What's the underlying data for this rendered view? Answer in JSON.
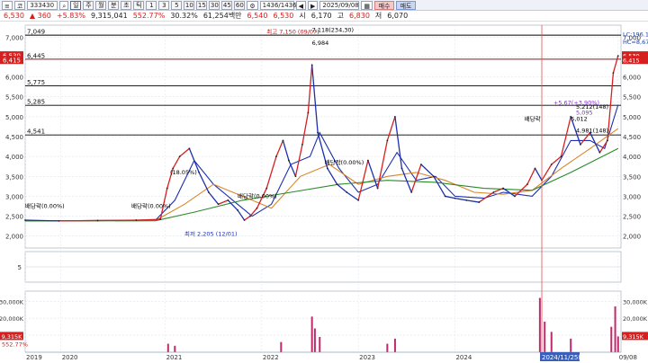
{
  "toolbar": {
    "menu_label": "≡",
    "market_label": "코",
    "code": "333430",
    "period_buttons": [
      "일",
      "주",
      "월",
      "분",
      "초",
      "틱"
    ],
    "minute_buttons": [
      "1",
      "3",
      "5",
      "10",
      "15",
      "30",
      "45",
      "60"
    ],
    "active_period": "일",
    "count": "1436/1436",
    "date": "2025/09/08",
    "buy_label": "매수",
    "sell_label": "매도"
  },
  "quote": {
    "price": "6,530",
    "change": "▲ 360",
    "change_rate": "+5.83%",
    "volume": "9,315,041",
    "volume_ratio": "552.77%",
    "turnover": "30.32%",
    "amount": "61,254백만",
    "open_label": "시",
    "open": "6,170",
    "high_label": "고",
    "high": "6,830",
    "low_label": "저",
    "low": "6,070",
    "close": "6,540",
    "prev": "6,530"
  },
  "chart_data": {
    "type": "line",
    "ylim": [
      1700,
      7300
    ],
    "y_ticks": [
      2000,
      2500,
      3000,
      3500,
      4000,
      4500,
      5000,
      5500,
      6000,
      6500,
      7000
    ],
    "y_tick_labels": [
      "2,000",
      "2,500",
      "3,000",
      "3,500",
      "4,000",
      "4,500",
      "5,000",
      "5,500",
      "6,000",
      "6,500",
      "7,000"
    ],
    "x_labels": [
      "2019",
      "2020",
      "2021",
      "2022",
      "2023",
      "2024",
      "09/08"
    ],
    "x_label_dates": [
      2019.55,
      2019.92,
      2021.0,
      2022.0,
      2023.0,
      2024.0,
      2025.69
    ],
    "x_range": [
      2019.55,
      2025.72
    ],
    "h_lines": [
      {
        "label": "7,049",
        "value": 7049,
        "color": "#000000"
      },
      {
        "label": "6,445",
        "value": 6445,
        "color": "#8a1a1a"
      },
      {
        "label": "5,775",
        "value": 5775,
        "color": "#000000"
      },
      {
        "label": "5,285",
        "value": 5285,
        "color": "#000000"
      },
      {
        "label": "4,541",
        "value": 4541,
        "color": "#000000"
      }
    ],
    "right_tags": [
      {
        "text": "LC:196.1",
        "value": 7070,
        "color": "#1a3fa8"
      },
      {
        "text": "HC=8,67",
        "value": 6880,
        "color": "#1a3fa8"
      },
      {
        "text": "6,530",
        "value": 6530,
        "color": "#ffffff",
        "bg": "#d62020"
      },
      {
        "text": "6,415",
        "value": 6415,
        "color": "#ffffff",
        "bg": "#d62020"
      }
    ],
    "left_price_tags": [
      {
        "text": "6,530",
        "value": 6530
      },
      {
        "text": "6,415",
        "value": 6415
      }
    ],
    "price_series": {
      "name": "close",
      "x": [
        2019.55,
        2019.9,
        2020.3,
        2020.7,
        2020.95,
        2021.02,
        2021.08,
        2021.15,
        2021.25,
        2021.35,
        2021.45,
        2021.55,
        2021.65,
        2021.75,
        2021.82,
        2021.88,
        2021.95,
        2022.05,
        2022.15,
        2022.22,
        2022.28,
        2022.35,
        2022.42,
        2022.48,
        2022.52,
        2022.58,
        2022.68,
        2022.78,
        2022.88,
        2023.0,
        2023.1,
        2023.2,
        2023.3,
        2023.38,
        2023.45,
        2023.55,
        2023.65,
        2023.78,
        2023.9,
        2024.0,
        2024.12,
        2024.25,
        2024.4,
        2024.5,
        2024.62,
        2024.75,
        2024.83,
        2024.9,
        2025.0,
        2025.1,
        2025.2,
        2025.3,
        2025.4,
        2025.5,
        2025.58,
        2025.64,
        2025.69
      ],
      "values": [
        2400,
        2380,
        2390,
        2400,
        2420,
        3200,
        3700,
        4000,
        4200,
        3600,
        3100,
        2800,
        2900,
        2650,
        2400,
        2500,
        2700,
        3200,
        4000,
        4400,
        3900,
        3500,
        4300,
        5100,
        6300,
        4600,
        3700,
        3300,
        3100,
        2900,
        3900,
        3200,
        4400,
        5000,
        3700,
        3100,
        3800,
        3500,
        3000,
        2950,
        2900,
        2850,
        3100,
        3200,
        3000,
        3300,
        3700,
        3400,
        3800,
        4000,
        5000,
        4300,
        4600,
        4100,
        4400,
        6100,
        6530
      ]
    },
    "ma_series": [
      {
        "name": "ma-short",
        "color": "#1c2fb0",
        "x": [
          2019.55,
          2020.9,
          2021.1,
          2021.3,
          2021.5,
          2021.7,
          2021.9,
          2022.1,
          2022.3,
          2022.5,
          2022.6,
          2022.8,
          2023.0,
          2023.2,
          2023.4,
          2023.6,
          2023.8,
          2024.0,
          2024.3,
          2024.5,
          2024.8,
          2025.0,
          2025.2,
          2025.4,
          2025.55,
          2025.69
        ],
        "values": [
          2380,
          2400,
          2900,
          3900,
          3300,
          2900,
          2500,
          2800,
          3800,
          4000,
          4600,
          3700,
          3100,
          3300,
          4100,
          3400,
          3500,
          3000,
          2950,
          3100,
          3000,
          3500,
          4400,
          4400,
          4200,
          5300
        ]
      },
      {
        "name": "ma-mid",
        "color": "#d9852a",
        "x": [
          2019.55,
          2020.9,
          2021.2,
          2021.5,
          2021.8,
          2022.1,
          2022.4,
          2022.7,
          2023.0,
          2023.3,
          2023.6,
          2023.9,
          2024.2,
          2024.5,
          2024.8,
          2025.1,
          2025.4,
          2025.69
        ],
        "values": [
          2380,
          2390,
          2800,
          3300,
          3000,
          2700,
          3500,
          3800,
          3300,
          3500,
          3600,
          3400,
          3100,
          3050,
          3150,
          3700,
          4200,
          4700
        ]
      },
      {
        "name": "ma-long",
        "color": "#2a8a2a",
        "x": [
          2019.55,
          2020.9,
          2021.3,
          2021.8,
          2022.3,
          2022.8,
          2023.3,
          2023.8,
          2024.3,
          2024.8,
          2025.2,
          2025.69
        ],
        "values": [
          2380,
          2385,
          2600,
          2900,
          3100,
          3300,
          3400,
          3350,
          3200,
          3150,
          3600,
          4200
        ]
      }
    ],
    "annotations": [
      {
        "text": "최고 7,150 (09/07)",
        "x": 2022.05,
        "value": 7080,
        "color": "#c01818"
      },
      {
        "text": "7,118(234,30)",
        "x": 2022.52,
        "value": 7130,
        "color": "#000000"
      },
      {
        "text": "6,984",
        "x": 2022.52,
        "value": 6800,
        "color": "#000000"
      },
      {
        "text": "(18.05%)",
        "x": 2021.05,
        "value": 3550,
        "color": "#000000"
      },
      {
        "text": "배당락(0.00%)",
        "x": 2020.65,
        "value": 2700,
        "color": "#000000"
      },
      {
        "text": "배당락(0.00%)",
        "x": 2019.55,
        "value": 2700,
        "color": "#000000"
      },
      {
        "text": "배당락(0.00%)",
        "x": 2021.75,
        "value": 2950,
        "color": "#000000"
      },
      {
        "text": "배당락(0.00%)",
        "x": 2022.65,
        "value": 3800,
        "color": "#000000"
      },
      {
        "text": "배당락",
        "x": 2024.72,
        "value": 4900,
        "color": "#000000"
      },
      {
        "text": "최저 2,205 (12/01)",
        "x": 2021.2,
        "value": 2000,
        "color": "#1c2fb0"
      },
      {
        "text": "+5.67(+3.90%)",
        "x": 2025.02,
        "value": 5300,
        "color": "#8a2bd8"
      },
      {
        "text": "5,012",
        "x": 2025.2,
        "value": 4900,
        "color": "#000000"
      },
      {
        "text": "4,981(148)",
        "x": 2025.45,
        "value": 4600,
        "color": "#000000"
      },
      {
        "text": "5,212(148)",
        "x": 2025.45,
        "value": 5200,
        "color": "#000000"
      },
      {
        "text": "5,095",
        "x": 2025.4,
        "value": 5050,
        "color": "#8a2bd8"
      }
    ],
    "volume_panel": {
      "ylim": [
        0,
        36000
      ],
      "y_ticks": [
        10000,
        20000,
        30000
      ],
      "y_tick_labels": [
        "10,000K",
        "20,000K",
        "30,000K"
      ],
      "current_label": "9,315K",
      "current_value": 9315,
      "ratio_label": "552.77%",
      "highlight_date": "2024/11/25(월)",
      "highlight_x": 2024.9,
      "spikes": [
        {
          "x": 2021.03,
          "value": 5000
        },
        {
          "x": 2021.1,
          "value": 3800
        },
        {
          "x": 2022.2,
          "value": 6000
        },
        {
          "x": 2022.52,
          "value": 21000
        },
        {
          "x": 2022.55,
          "value": 14000
        },
        {
          "x": 2022.6,
          "value": 9000
        },
        {
          "x": 2023.3,
          "value": 5000
        },
        {
          "x": 2023.38,
          "value": 8000
        },
        {
          "x": 2024.88,
          "value": 32000
        },
        {
          "x": 2024.93,
          "value": 18000
        },
        {
          "x": 2025.0,
          "value": 12000
        },
        {
          "x": 2025.2,
          "value": 8000
        },
        {
          "x": 2025.62,
          "value": 15000
        },
        {
          "x": 2025.66,
          "value": 27000
        },
        {
          "x": 2025.69,
          "value": 9315
        }
      ]
    },
    "indicator_panel": {
      "label": "5",
      "value_label": "5"
    }
  }
}
